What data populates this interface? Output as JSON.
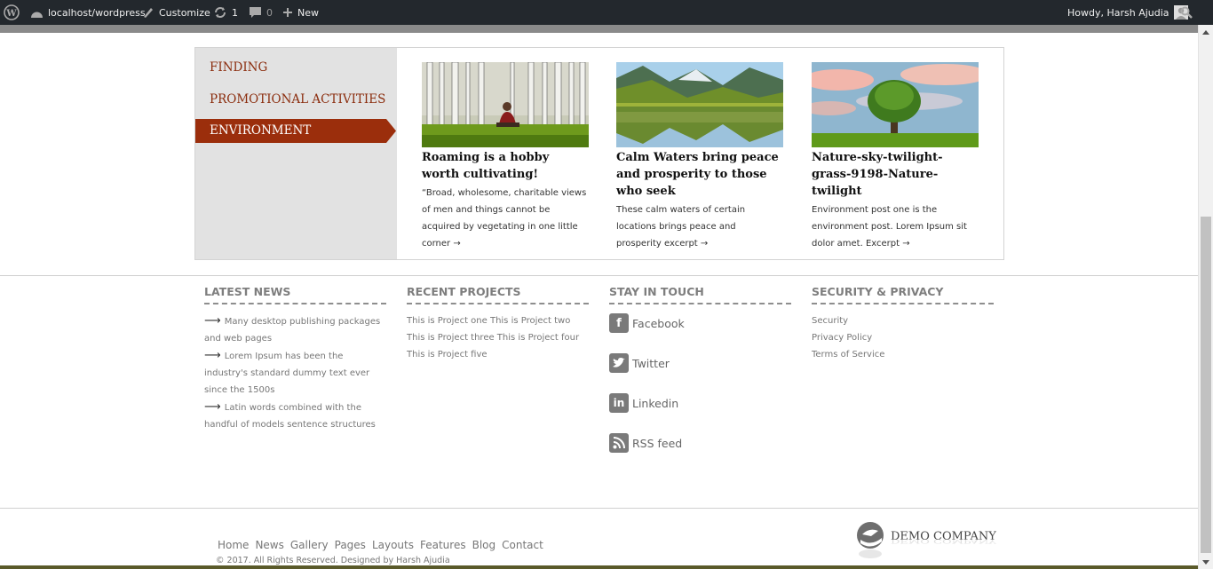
{
  "admin_bar": {
    "site": "localhost/wordpress",
    "customize": "Customize",
    "updates_count": "1",
    "comments_count": "0",
    "new": "New",
    "howdy": "Howdy, Harsh Ajudia"
  },
  "tabs": {
    "items": [
      "FINDING",
      "PROMOTIONAL ACTIVITIES",
      "ENVIRONMENT"
    ],
    "active": "ENVIRONMENT"
  },
  "posts": [
    {
      "title": "Roaming is a hobby worth cultivating!",
      "excerpt": "“Broad, wholesome, charitable views of men and things cannot be acquired by vegetating in one little corner →"
    },
    {
      "title": "Calm Waters bring peace and prosperity to those who seek",
      "excerpt": "These calm waters of certain locations brings peace and prosperity excerpt →"
    },
    {
      "title": "Nature-sky-twilight-grass-9198-Nature-twilight",
      "excerpt": "Environment post one is the environment post. Lorem Ipsum sit dolor amet. Excerpt →"
    }
  ],
  "footer": {
    "latest_news": {
      "title": "LATEST NEWS",
      "items": [
        "Many desktop publishing packages and web pages",
        "Lorem Ipsum has been the industry's standard dummy text ever since the 1500s",
        "Latin words combined with the handful of models sentence structures"
      ]
    },
    "recent_projects": {
      "title": "RECENT PROJECTS",
      "text": "This is Project one This is  Project two This is  Project three This is  Project four This is  Project five"
    },
    "stay_in_touch": {
      "title": "STAY IN TOUCH",
      "links": [
        "Facebook",
        "Twitter",
        "Linkedin",
        "RSS feed"
      ]
    },
    "security": {
      "title": "SECURITY & PRIVACY",
      "links": [
        "Security",
        "Privacy Policy",
        "Terms of Service"
      ]
    }
  },
  "bottom": {
    "nav": [
      "Home",
      "News",
      "Gallery",
      "Pages",
      "Layouts",
      "Features",
      "Blog",
      "Contact"
    ],
    "copyright": "© 2017. All Rights Reserved. Designed by Harsh Ajudia",
    "logo_text": "DEMO COMPANY"
  },
  "colors": {
    "accent": "#9b2e0c",
    "admin_bar": "#23282d"
  }
}
